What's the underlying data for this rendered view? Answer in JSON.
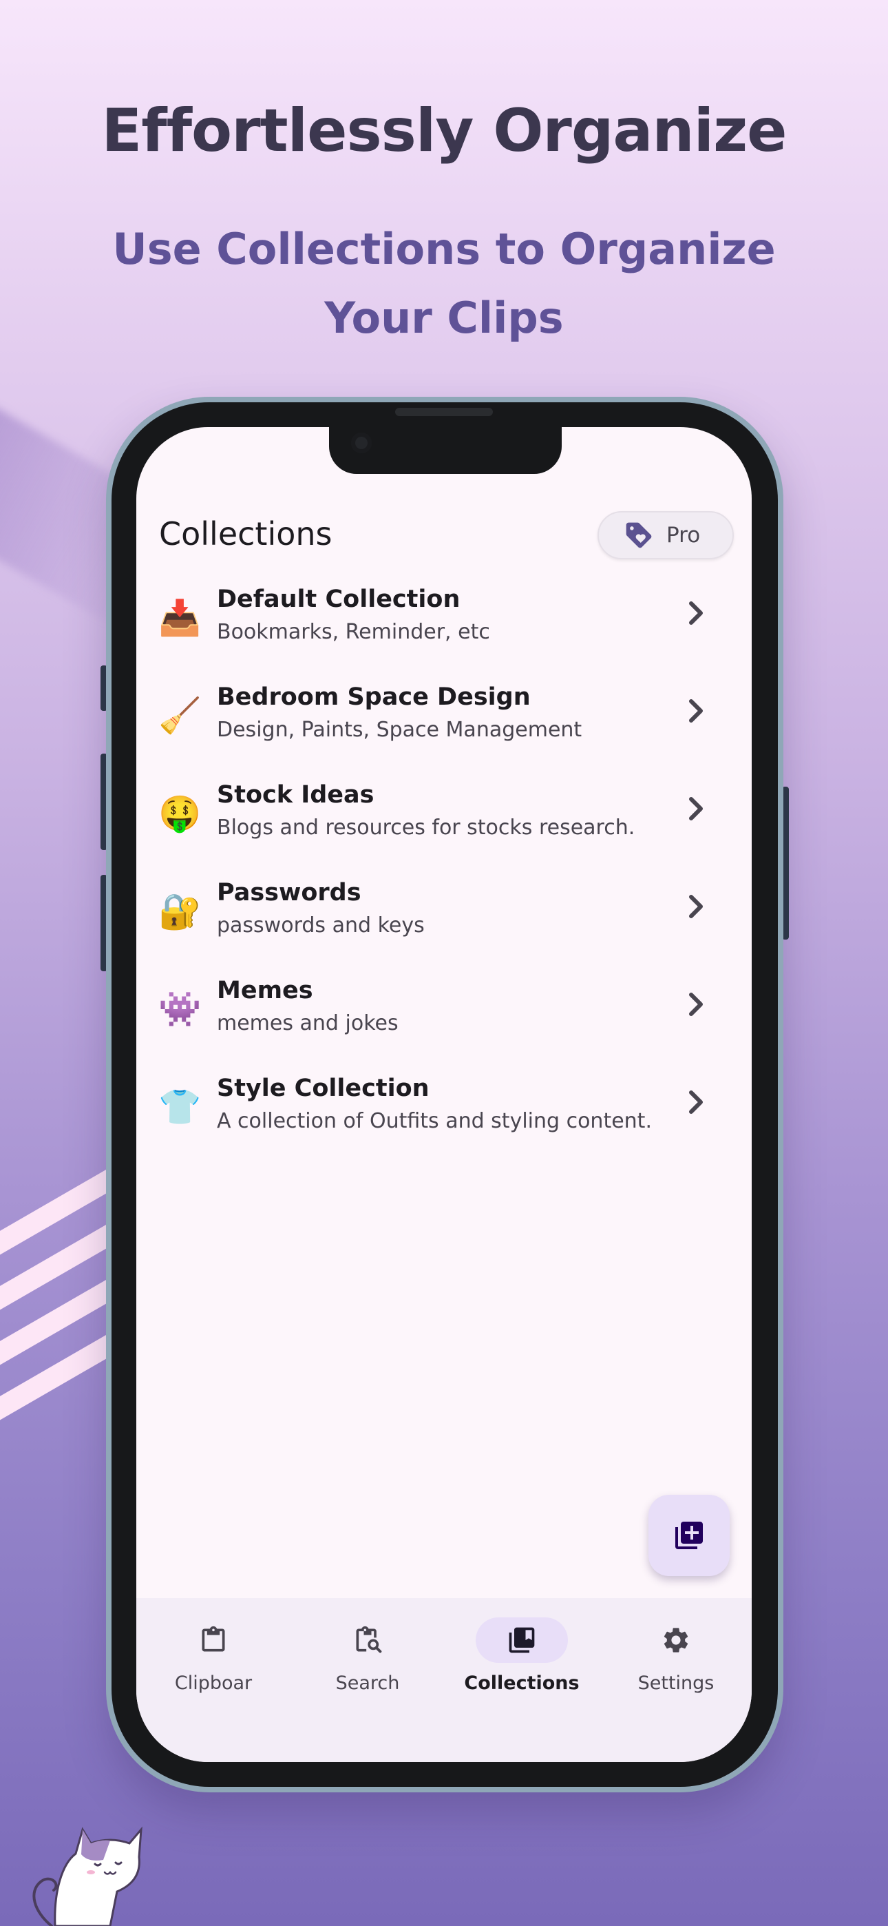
{
  "headline": "Effortlessly Organize",
  "subheadline": "Use Collections to Organize Your Clips",
  "app": {
    "title": "Collections",
    "pro_label": "Pro"
  },
  "collections": [
    {
      "emoji": "📥",
      "icon": "inbox-tray-icon",
      "title": "Default Collection",
      "subtitle": "Bookmarks, Reminder, etc"
    },
    {
      "emoji": "🧹",
      "icon": "broom-icon",
      "title": "Bedroom Space Design",
      "subtitle": "Design, Paints, Space Management"
    },
    {
      "emoji": "🤑",
      "icon": "money-mouth-face-icon",
      "title": "Stock Ideas",
      "subtitle": "Blogs and resources for stocks research."
    },
    {
      "emoji": "🔐",
      "icon": "locked-with-key-icon",
      "title": "Passwords",
      "subtitle": "passwords and keys"
    },
    {
      "emoji": "👾",
      "icon": "alien-monster-icon",
      "title": "Memes",
      "subtitle": "memes and jokes"
    },
    {
      "emoji": "👕",
      "icon": "shirt-icon",
      "title": "Style Collection",
      "subtitle": "A collection of Outfits and styling content."
    }
  ],
  "nav": [
    {
      "label": "Clipboar",
      "icon": "clipboard-icon",
      "active": false
    },
    {
      "label": "Search",
      "icon": "search-clipboard-icon",
      "active": false
    },
    {
      "label": "Collections",
      "icon": "collections-icon",
      "active": true
    },
    {
      "label": "Settings",
      "icon": "gear-icon",
      "active": false
    }
  ],
  "colors": {
    "headline": "#3c374f",
    "subheadline": "#5f5297",
    "accent_container": "#e8def8",
    "screen_bg": "#fdf6fb"
  }
}
